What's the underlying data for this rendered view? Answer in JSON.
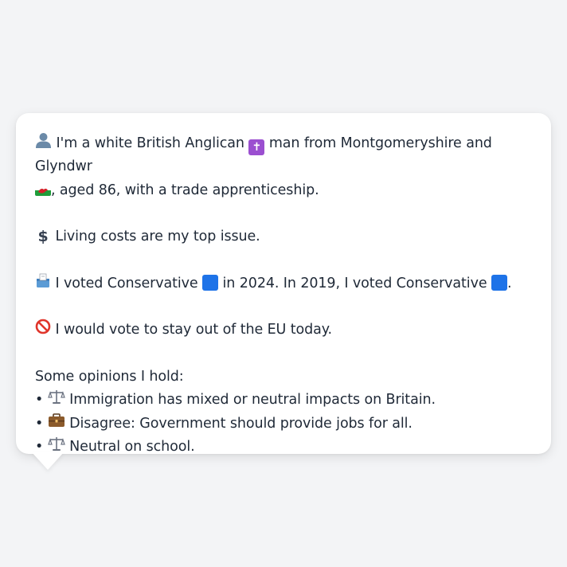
{
  "profile": {
    "intro_part1": "I'm a white British Anglican",
    "intro_part2": "man from Montgomeryshire and Glyndwr",
    "intro_part3": ", aged 86, with a trade apprenticeship.",
    "issue": "Living costs are my top issue.",
    "vote_part1": "I voted Conservative",
    "vote_part2": "in 2024. In 2019, I voted Conservative",
    "vote_part3": ".",
    "eu": "I would vote to stay out of the EU today.",
    "opinions_heading": "Some opinions I hold:",
    "opinions": [
      {
        "bullet": "•",
        "text": "Immigration has mixed or neutral impacts on Britain."
      },
      {
        "bullet": "•",
        "text": "Disagree: Government should provide jobs for all."
      },
      {
        "bullet": "•",
        "text": "Neutral on school."
      }
    ]
  },
  "icons": {
    "person": "person-silhouette-icon",
    "cross": "latin-cross-icon",
    "flag": "wales-flag-icon",
    "money": "dollar-sign-icon",
    "ballot": "ballot-box-icon",
    "party": "blue-square-icon",
    "no": "prohibited-icon",
    "scales": "balance-scale-icon",
    "briefcase": "briefcase-icon"
  },
  "colors": {
    "background": "#f3f4f6",
    "bubble": "#ffffff",
    "text": "#1f2937",
    "conservative_blue": "#1e73e8",
    "religion_purple": "#9b4fd0",
    "prohibited_red": "#e0352b"
  }
}
